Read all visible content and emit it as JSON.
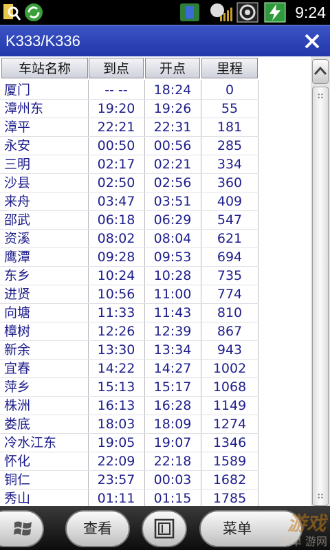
{
  "status_bar": {
    "time": "9:24",
    "icons": [
      "search-icon",
      "sync-icon",
      "connectivity-icon",
      "signal-icon",
      "volume-icon",
      "battery-icon"
    ]
  },
  "window": {
    "title": "K333/K336",
    "close_icon": "close-icon"
  },
  "table": {
    "columns": [
      "车站名称",
      "到点",
      "开点",
      "里程"
    ],
    "rows": [
      [
        "厦门",
        "-- --",
        "18:24",
        "0"
      ],
      [
        "漳州东",
        "19:20",
        "19:26",
        "55"
      ],
      [
        "漳平",
        "22:21",
        "22:31",
        "181"
      ],
      [
        "永安",
        "00:50",
        "00:56",
        "285"
      ],
      [
        "三明",
        "02:17",
        "02:21",
        "334"
      ],
      [
        "沙县",
        "02:50",
        "02:56",
        "360"
      ],
      [
        "来舟",
        "03:47",
        "03:51",
        "409"
      ],
      [
        "邵武",
        "06:18",
        "06:29",
        "547"
      ],
      [
        "资溪",
        "08:02",
        "08:04",
        "621"
      ],
      [
        "鹰潭",
        "09:28",
        "09:53",
        "694"
      ],
      [
        "东乡",
        "10:24",
        "10:28",
        "735"
      ],
      [
        "进贤",
        "10:56",
        "11:00",
        "774"
      ],
      [
        "向塘",
        "11:33",
        "11:43",
        "810"
      ],
      [
        "樟树",
        "12:26",
        "12:39",
        "867"
      ],
      [
        "新余",
        "13:30",
        "13:34",
        "943"
      ],
      [
        "宜春",
        "14:22",
        "14:27",
        "1002"
      ],
      [
        "萍乡",
        "15:13",
        "15:17",
        "1068"
      ],
      [
        "株洲",
        "16:13",
        "16:28",
        "1149"
      ],
      [
        "娄底",
        "18:03",
        "18:09",
        "1274"
      ],
      [
        "冷水江东",
        "19:05",
        "19:07",
        "1346"
      ],
      [
        "怀化",
        "22:09",
        "22:18",
        "1589"
      ],
      [
        "铜仁",
        "23:57",
        "00:03",
        "1682"
      ],
      [
        "秀山",
        "01:11",
        "01:15",
        "1785"
      ]
    ]
  },
  "bottom_bar": {
    "start_icon": "windows-logo-icon",
    "view_label": "查看",
    "keyboard_icon": "keyboard-icon",
    "menu_label": "菜单"
  },
  "watermark": {
    "line1": "游戏",
    "line2": "菜单 游网"
  },
  "colors": {
    "title_bar": "#2a3fb2",
    "table_text": "#1e1e8c",
    "status_bar": "#000000",
    "bottom_bar": "#1a1a1a"
  }
}
